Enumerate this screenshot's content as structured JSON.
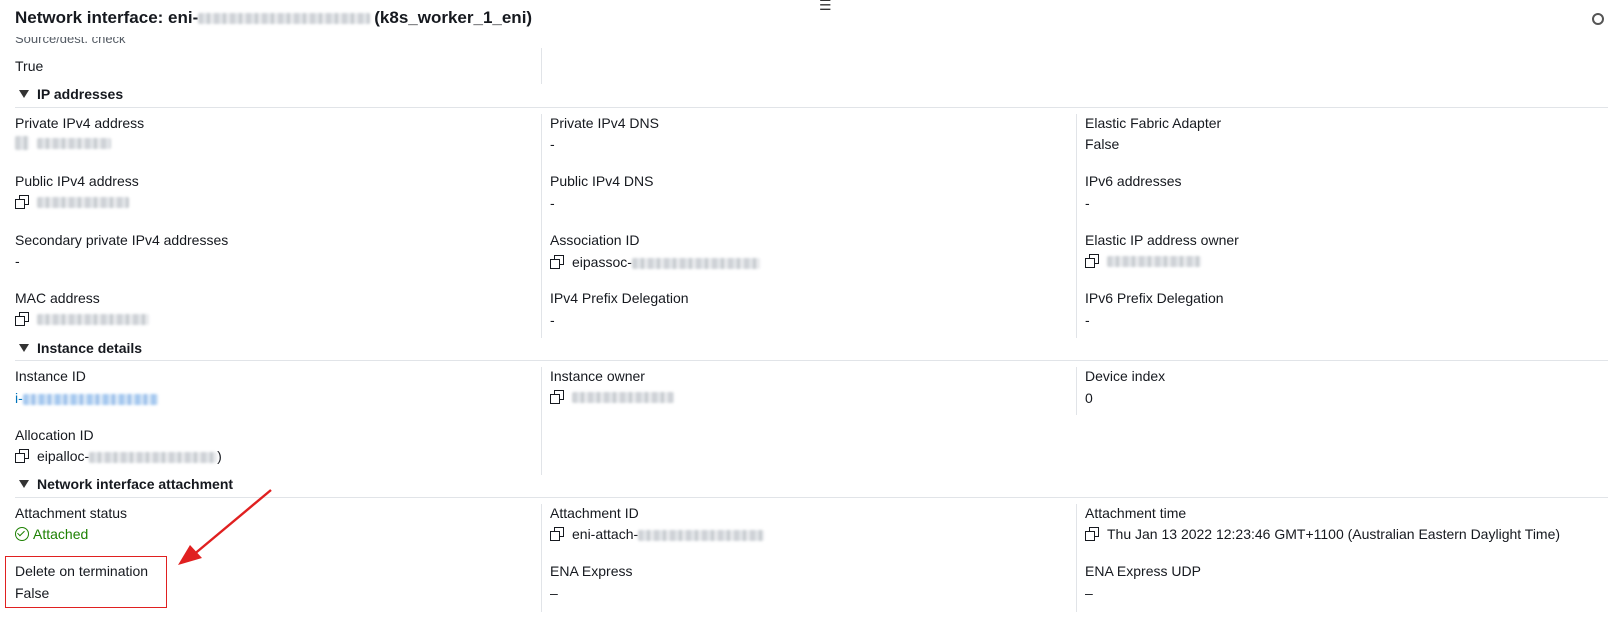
{
  "header": {
    "title_prefix": "Network interface: eni-",
    "title_suffix": "(k8s_worker_1_eni)"
  },
  "top": {
    "source_dest_label": "Source/dest. check",
    "source_dest_value": "True"
  },
  "ip_addresses": {
    "header": "IP addresses",
    "private_ipv4_label": "Private IPv4 address",
    "private_ipv4_dns_label": "Private IPv4 DNS",
    "private_ipv4_dns_value": "-",
    "efa_label": "Elastic Fabric Adapter",
    "efa_value": "False",
    "public_ipv4_label": "Public IPv4 address",
    "public_ipv4_dns_label": "Public IPv4 DNS",
    "public_ipv4_dns_value": "-",
    "ipv6_label": "IPv6 addresses",
    "ipv6_value": "-",
    "secondary_label": "Secondary private IPv4 addresses",
    "secondary_value": "-",
    "association_label": "Association ID",
    "association_prefix": "eipassoc-",
    "eip_owner_label": "Elastic IP address owner",
    "mac_label": "MAC address",
    "ipv4_prefix_label": "IPv4 Prefix Delegation",
    "ipv4_prefix_value": "-",
    "ipv6_prefix_label": "IPv6 Prefix Delegation",
    "ipv6_prefix_value": "-"
  },
  "instance_details": {
    "header": "Instance details",
    "instance_id_label": "Instance ID",
    "instance_id_prefix": "i-",
    "instance_owner_label": "Instance owner",
    "device_index_label": "Device index",
    "device_index_value": "0",
    "allocation_label": "Allocation ID",
    "allocation_prefix": "eipalloc-",
    "allocation_suffix": ")"
  },
  "attachment": {
    "header": "Network interface attachment",
    "status_label": "Attachment status",
    "status_value": "Attached",
    "attachment_id_label": "Attachment ID",
    "attachment_id_prefix": "eni-attach-",
    "attachment_time_label": "Attachment time",
    "attachment_time_value": "Thu Jan 13 2022 12:23:46 GMT+1100 (Australian Eastern Daylight Time)",
    "delete_label": "Delete on termination",
    "delete_value": "False",
    "ena_express_label": "ENA Express",
    "ena_express_value": "–",
    "ena_udp_label": "ENA Express UDP",
    "ena_udp_value": "–"
  },
  "colors": {
    "link": "#0073bb",
    "success": "#1d8102",
    "annotation": "#e02020"
  },
  "icons": [
    "copy-icon",
    "check-circle-icon",
    "caret-down-icon",
    "menu-icon",
    "gear-icon",
    "annotation-arrow"
  ]
}
